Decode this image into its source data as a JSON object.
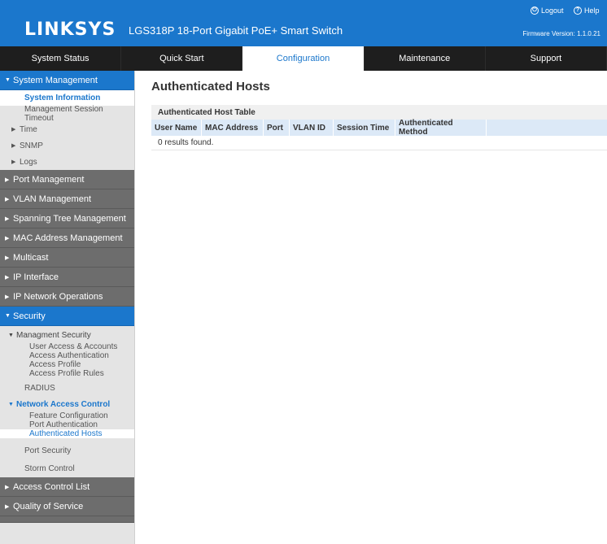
{
  "header": {
    "brand": "LINKSYS",
    "product": "LGS318P 18-Port Gigabit PoE+ Smart Switch",
    "logout_label": "Logout",
    "help_label": "Help",
    "firmware": "Firmware Version: 1.1.0.21"
  },
  "nav": {
    "tabs": [
      "System Status",
      "Quick Start",
      "Configuration",
      "Maintenance",
      "Support"
    ],
    "active": "Configuration"
  },
  "sidebar": {
    "system_management": "System Management",
    "system_management_items": [
      "System Information",
      "Management Session Timeout",
      "Time",
      "SNMP",
      "Logs"
    ],
    "sections": [
      "Port Management",
      "VLAN Management",
      "Spanning Tree Management",
      "MAC Address Management",
      "Multicast",
      "IP Interface",
      "IP Network Operations"
    ],
    "security": "Security",
    "management_security": "Managment Security",
    "management_security_items": [
      "User Access & Accounts",
      "Access Authentication",
      "Access Profile",
      "Access Profile Rules"
    ],
    "radius": "RADIUS",
    "network_access_control": "Network Access Control",
    "nac_items": [
      "Feature Configuration",
      "Port Authentication",
      "Authenticated Hosts"
    ],
    "port_security": "Port Security",
    "storm_control": "Storm Control",
    "bottom_sections": [
      "Access Control List",
      "Quality of Service"
    ]
  },
  "main": {
    "title": "Authenticated Hosts",
    "table_title": "Authenticated Host Table",
    "columns": [
      "User Name",
      "MAC Address",
      "Port",
      "VLAN ID",
      "Session Time",
      "Authenticated Method"
    ],
    "empty_text": "0 results found."
  },
  "colors": {
    "brand_blue": "#1b77cc",
    "nav_dark": "#1e1e1e",
    "section_gray": "#6d6d6d"
  }
}
